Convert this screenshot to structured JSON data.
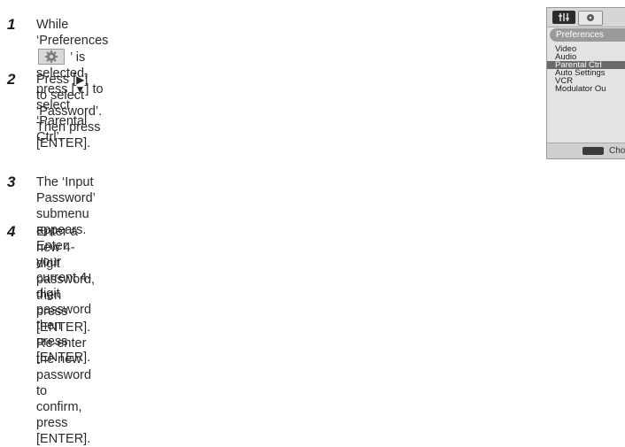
{
  "steps": [
    {
      "number": "1",
      "line1_before_icon": "While ‘Preferences ",
      "line1_after_icon": " ’ is selected, press [",
      "line1_symbol": "▼",
      "line1_end": "] to select ‘Parental",
      "line2": "Ctrl’."
    },
    {
      "number": "2",
      "before_symbol": "Press [",
      "symbol": "▶",
      "after_symbol": "] to select ‘Password’. Then press [ENTER]."
    },
    {
      "number": "3",
      "line1": "The ‘Input Password’ submenu appears. Enter your current 4-digit",
      "line2": "password then press [ENTER]."
    },
    {
      "number": "4",
      "line1": "Enter a new 4-digit password, then press [ENTER]. Re-enter the new password to",
      "line2": "confirm, press [ENTER]."
    }
  ],
  "menu": {
    "title": "Preferences",
    "items": [
      "Video",
      "Audio",
      "Parental Ctrl",
      "Auto Settings",
      "VCR",
      "Modulator Ou"
    ],
    "selected_index": 2,
    "footer_label": "Choo"
  },
  "icons": {
    "preferences": "gear-icon",
    "menu_tab_1": "setup-icon",
    "menu_tab_2": "disc-icon",
    "footer": "navigation-keys-icon"
  }
}
